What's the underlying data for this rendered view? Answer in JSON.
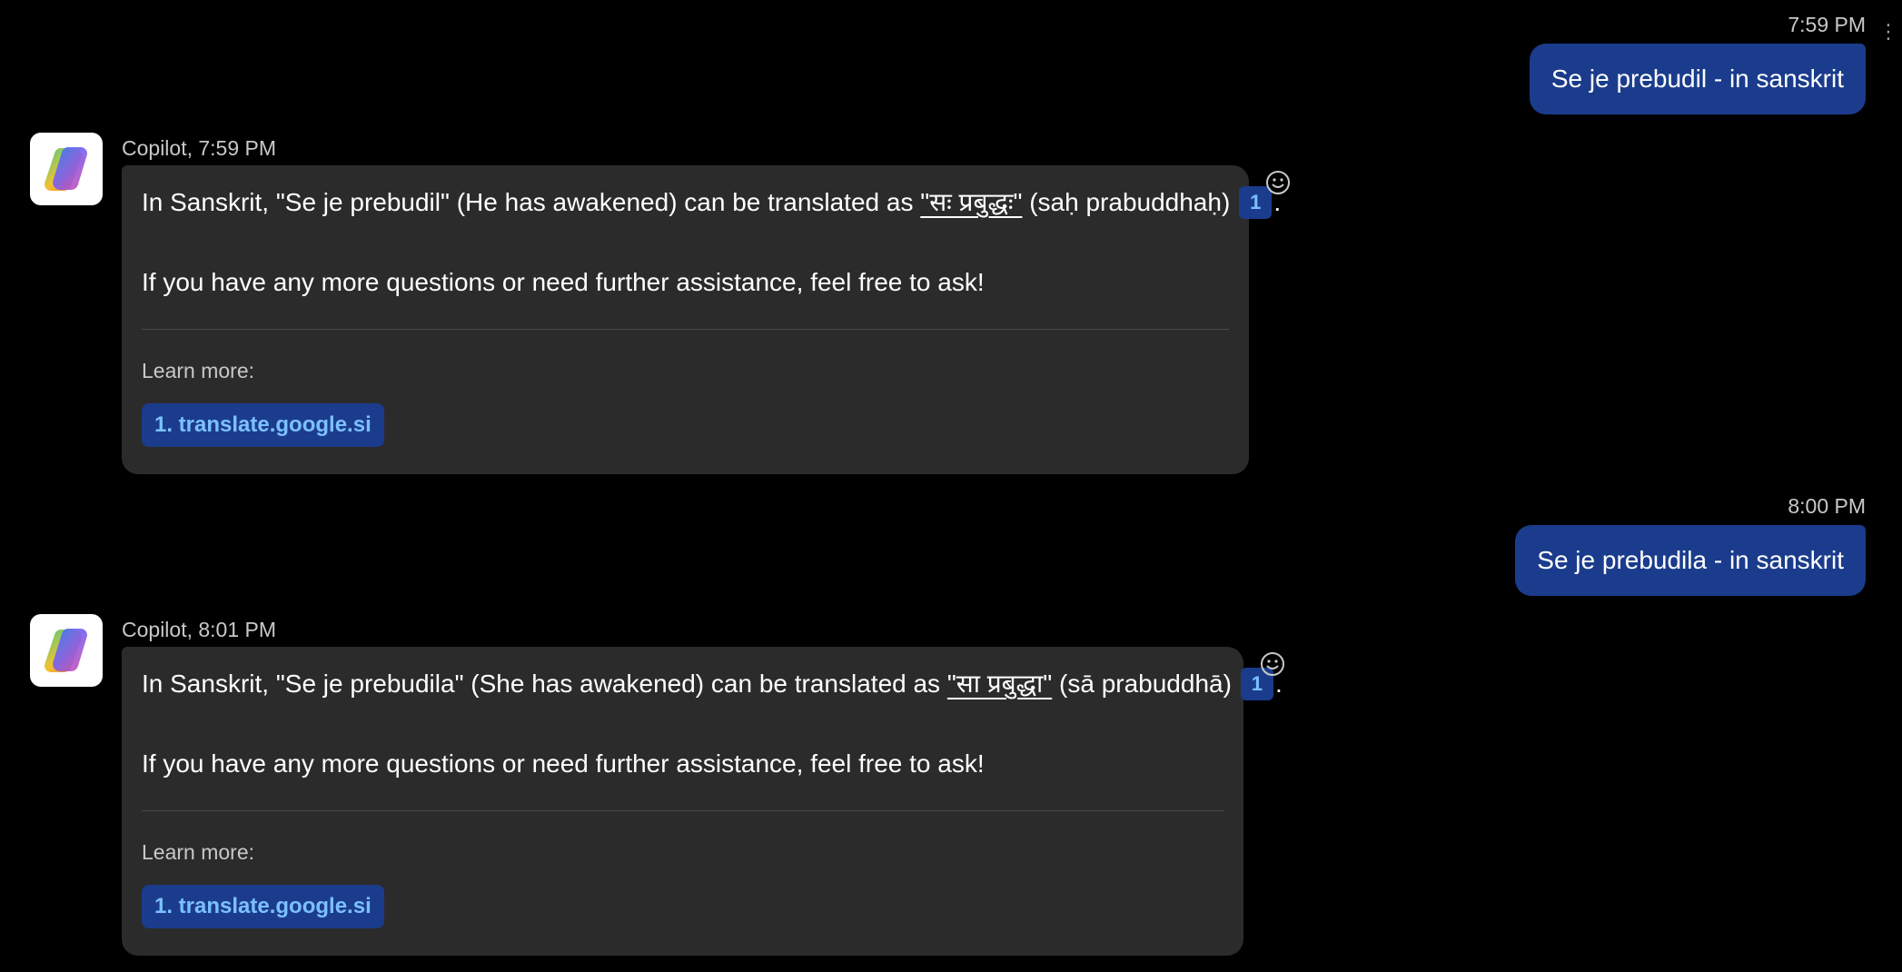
{
  "conversation": [
    {
      "role": "user",
      "timestamp": "7:59 PM",
      "text": "Se je prebudil - in sanskrit"
    },
    {
      "role": "assistant",
      "header": "Copilot, 7:59 PM",
      "line1_pre": "In Sanskrit, \"Se je prebudil\" (He has awakened) can be translated as ",
      "line1_quote": "\"सः प्रबुद्धः\"",
      "line1_post": " (saḥ prabuddhaḥ)",
      "citation": "1",
      "line1_end": ".",
      "line2": "If you have any more questions or need further assistance, feel free to ask!",
      "learn_more": "Learn more:",
      "source": "1. translate.google.si"
    },
    {
      "role": "user",
      "timestamp": "8:00 PM",
      "text": "Se je prebudila - in sanskrit"
    },
    {
      "role": "assistant",
      "header": "Copilot, 8:01 PM",
      "line1_pre": "In Sanskrit, \"Se je prebudila\" (She has awakened) can be translated as ",
      "line1_quote": "\"सा प्रबुद्धा\"",
      "line1_post": " (sā prabuddhā)",
      "citation": "1",
      "line1_end": ".",
      "line2": "If you have any more questions or need further assistance, feel free to ask!",
      "learn_more": "Learn more:",
      "source": "1. translate.google.si"
    }
  ],
  "icons": {
    "avatar": "copilot-logo-icon",
    "react": "smiley-icon",
    "more": "kebab-menu-icon"
  },
  "colors": {
    "background": "#000000",
    "user_bubble": "#1b3c8c",
    "bot_bubble": "#2b2b2b",
    "link_text": "#7cc0ff"
  }
}
